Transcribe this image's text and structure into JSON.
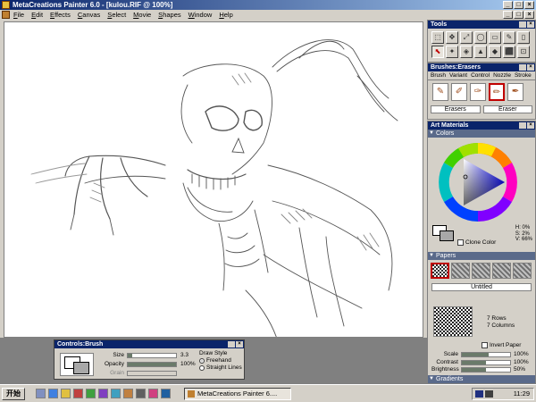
{
  "window": {
    "title": "MetaCreations Painter 6.0 - [kulou.RIF @ 100%]",
    "min": "_",
    "max": "□",
    "close": "×"
  },
  "menu": [
    "File",
    "Edit",
    "Effects",
    "Canvas",
    "Select",
    "Movie",
    "Shapes",
    "Window",
    "Help"
  ],
  "tools": {
    "title": "Tools",
    "icons": [
      "⬚",
      "✥",
      "⤢",
      "◯",
      "▭",
      "✎",
      "▯",
      "⬉",
      "✦",
      "◈",
      "▲",
      "◆",
      "⬛",
      "⊡"
    ]
  },
  "brushes": {
    "title": "Brushes:Erasers",
    "tabs": [
      "Brush",
      "Variant",
      "Control",
      "Nozzle",
      "Stroke"
    ],
    "category": "Erasers",
    "variant": "Eraser"
  },
  "art_materials": {
    "title": "Art Materials"
  },
  "colors": {
    "title": "Colors",
    "h": "H:  0%",
    "s": "S:  2%",
    "v": "V: 66%",
    "clone_label": "Clone Color"
  },
  "papers": {
    "title": "Papers",
    "name": "Untitled",
    "rows": "7 Rows",
    "columns": "7 Columns",
    "invert_label": "Invert Paper",
    "scale_label": "Scale",
    "scale_value": "100%",
    "scale_level": 0.55,
    "contrast_label": "Contrast",
    "contrast_value": "100%",
    "contrast_level": 0.5,
    "brightness_label": "Brightness",
    "brightness_value": "50%",
    "brightness_level": 0.5
  },
  "gradients": {
    "title": "Gradients"
  },
  "controls": {
    "title": "Controls:Brush",
    "size_label": "Size",
    "size_value": "3.3",
    "size_level": 0.1,
    "opacity_label": "Opacity",
    "opacity_value": "100%",
    "opacity_level": 1.0,
    "grain_label": "Grain",
    "draw_style_label": "Draw Style",
    "freehand_label": "Freehand",
    "straight_label": "Straight Lines"
  },
  "taskbar": {
    "start_label": "开始",
    "task_label": "MetaCreations Painter 6....",
    "clock": "11:29"
  },
  "colors_hex": {
    "title_active": "#0a246a",
    "panel": "#d4d0c8",
    "accent_red": "#c00000"
  }
}
